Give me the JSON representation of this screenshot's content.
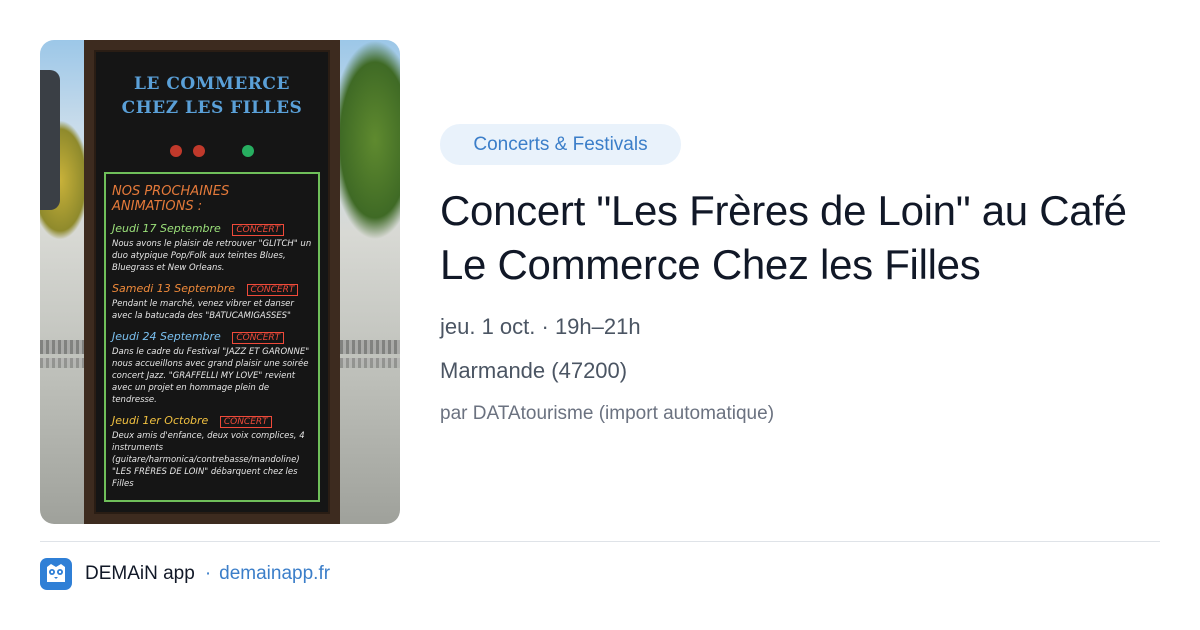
{
  "image": {
    "sign_header": [
      "LE COMMERCE",
      "CHEZ LES FILLES"
    ],
    "board_title": "NOS PROCHAINES ANIMATIONS :",
    "events": [
      {
        "date": "Jeudi 17 Septembre",
        "tag": "CONCERT",
        "body": "Nous avons le plaisir de retrouver \"GLITCH\" un duo atypique Pop/Folk aux teintes Blues, Bluegrass et New Orleans."
      },
      {
        "date": "Samedi 13 Septembre",
        "tag": "CONCERT",
        "body": "Pendant le marché, venez vibrer et danser avec la batucada des \"BATUCAMIGASSES\""
      },
      {
        "date": "Jeudi 24 Septembre",
        "tag": "CONCERT",
        "body": "Dans le cadre du Festival \"JAZZ ET GARONNE\" nous accueillons avec grand plaisir une soirée concert Jazz. \"GRAFFELLI MY LOVE\" revient avec un projet en hommage plein de tendresse."
      },
      {
        "date": "Jeudi 1er Octobre",
        "tag": "CONCERT",
        "body": "Deux amis d'enfance, deux voix complices, 4 instruments (guitare/harmonica/contrebasse/mandoline) \"LES FRÈRES DE LOIN\" débarquent chez les Filles"
      }
    ]
  },
  "category": "Concerts & Festivals",
  "title": "Concert \"Les Frères de Loin\" au Café Le Commerce Chez les Filles",
  "date_time": "jeu. 1 oct. · 19h–21h",
  "location": "Marmande (47200)",
  "author": "par DATAtourisme (import automatique)",
  "footer": {
    "app_name": "DEMAiN app",
    "separator": "·",
    "domain": "demainapp.fr"
  },
  "colors": {
    "accent": "#3b7ec9",
    "badge_bg": "#e9f2fb",
    "app_icon": "#2f7fd6"
  },
  "icons": {
    "app": "demain-app-icon"
  }
}
